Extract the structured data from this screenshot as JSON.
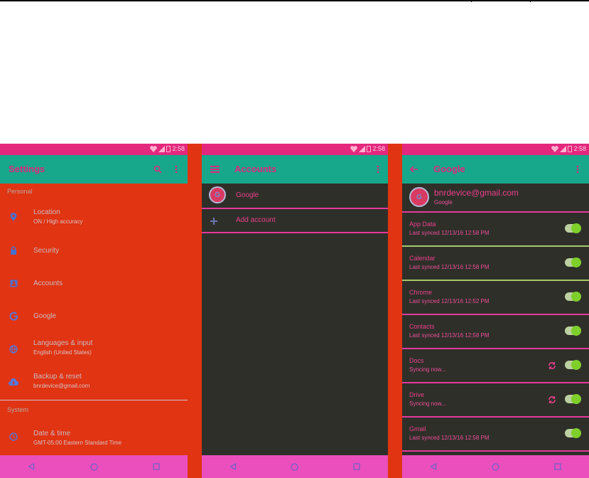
{
  "status_time": "2:58",
  "phone1": {
    "title": "Settings",
    "icons": [
      "search-icon",
      "more-vert-icon"
    ],
    "sections": [
      {
        "header": "Personal"
      },
      {
        "header": "System"
      }
    ],
    "items": [
      {
        "title": "Location",
        "subtitle": "ON / High accuracy",
        "icon": "location-pin-icon"
      },
      {
        "title": "Security",
        "subtitle": "",
        "icon": "lock-icon"
      },
      {
        "title": "Accounts",
        "subtitle": "",
        "icon": "account-box-icon"
      },
      {
        "title": "Google",
        "subtitle": "",
        "icon": "google-g-icon"
      },
      {
        "title": "Languages & input",
        "subtitle": "English (United States)",
        "icon": "globe-icon"
      },
      {
        "title": "Backup & reset",
        "subtitle": "bnrdevice@gmail.com",
        "icon": "cloud-upload-icon"
      },
      {
        "title": "Date & time",
        "subtitle": "GMT-05:00 Eastern Standard Time",
        "icon": "clock-icon"
      }
    ]
  },
  "phone2": {
    "title": "Accounts",
    "icons": [
      "menu-icon",
      "more-vert-icon"
    ],
    "accounts": [
      {
        "label": "Google"
      }
    ],
    "add_account": "Add account"
  },
  "phone3": {
    "title": "Google",
    "icons": [
      "back-arrow-icon",
      "more-vert-icon"
    ],
    "account_email": "bnrdevice@gmail.com",
    "account_type": "Google",
    "sync_items": [
      {
        "title": "App Data",
        "subtitle": "Last synced 12/13/16 12:58 PM",
        "syncing": false,
        "enabled": true
      },
      {
        "title": "Calendar",
        "subtitle": "Last synced 12/13/16 12:58 PM",
        "syncing": false,
        "enabled": true
      },
      {
        "title": "Chrome",
        "subtitle": "Last synced 12/13/16 12:52 PM",
        "syncing": false,
        "enabled": true
      },
      {
        "title": "Contacts",
        "subtitle": "Last synced 12/13/16 12:58 PM",
        "syncing": false,
        "enabled": true
      },
      {
        "title": "Docs",
        "subtitle": "Syncing now...",
        "syncing": true,
        "enabled": true
      },
      {
        "title": "Drive",
        "subtitle": "Syncing now...",
        "syncing": true,
        "enabled": true
      },
      {
        "title": "Gmail",
        "subtitle": "Last synced 12/13/16 12:58 PM",
        "syncing": false,
        "enabled": true
      }
    ]
  },
  "nav_buttons": [
    "back-triangle-icon",
    "home-circle-icon",
    "recents-square-icon"
  ],
  "colors": {
    "status_bar": "#e3287e",
    "app_bar": "#17a78b",
    "settings_bg": "#e03412",
    "dark_bg": "#2f2f2a",
    "nav_bar": "#ea4fbd",
    "accent_text": "#e8408a",
    "toggle_on": "#7ecf2a"
  }
}
